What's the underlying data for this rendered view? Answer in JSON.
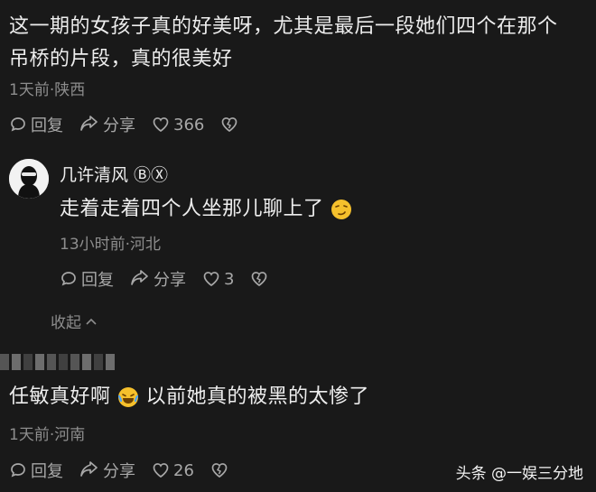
{
  "comment1": {
    "text_line1": "这一期的女孩子真的好美呀，尤其是最后一段她们四个在那个",
    "text_line2": "吊桥的片段，真的很美好",
    "meta": "1天前·陕西",
    "reply_label": "回复",
    "share_label": "分享",
    "like_count": "366"
  },
  "reply1": {
    "username": "几许清风 ⒷⓍ",
    "text": "走着走着四个人坐那儿聊上了",
    "meta": "13小时前·河北",
    "reply_label": "回复",
    "share_label": "分享",
    "like_count": "3"
  },
  "collapse_label": "收起",
  "comment2": {
    "text_before": "任敏真好啊",
    "text_after": "以前她真的被黑的太惨了",
    "meta": "1天前·河南",
    "reply_label": "回复",
    "share_label": "分享",
    "like_count": "26"
  },
  "watermark": "头条 @一娱三分地"
}
